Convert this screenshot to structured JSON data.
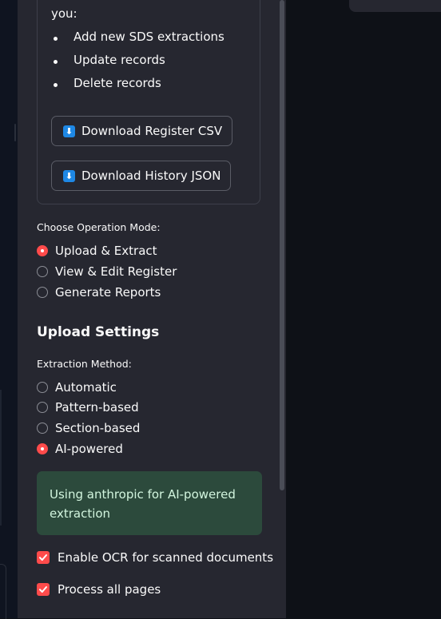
{
  "info_box": {
    "intro_tail": "you:",
    "bullets": [
      "Add new SDS extractions",
      "Update records",
      "Delete records"
    ],
    "download_register_label": "Download Register CSV",
    "download_history_label": "Download History JSON",
    "download_icon": "download-arrow-icon"
  },
  "operation_mode": {
    "label": "Choose Operation Mode:",
    "options": [
      "Upload & Extract",
      "View & Edit Register",
      "Generate Reports"
    ],
    "selected": "Upload & Extract"
  },
  "upload_settings": {
    "heading": "Upload Settings",
    "method_label": "Extraction Method:",
    "methods": [
      "Automatic",
      "Pattern-based",
      "Section-based",
      "AI-powered"
    ],
    "selected": "AI-powered",
    "status_message": "Using anthropic for AI-powered extraction",
    "ocr_label": "Enable OCR for scanned documents",
    "ocr_checked": true,
    "all_pages_label": "Process all pages",
    "all_pages_checked": true
  },
  "colors": {
    "accent": "#ff4b4b",
    "sidebar_bg": "#262730",
    "app_bg": "#0e1117",
    "success_bg": "#2c4a3c",
    "success_text": "#d2f5de",
    "download_icon_bg": "#1e88e5"
  }
}
